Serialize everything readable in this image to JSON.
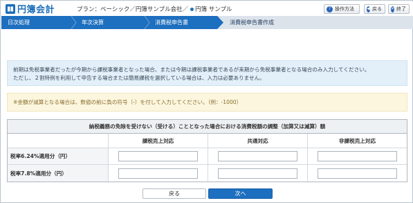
{
  "header": {
    "app_name": "円簿会計",
    "plan_text": "プラン：ベーシック／円簿サンプル会社／",
    "user_name": "円簿 サンプル",
    "help_label": "操作方法",
    "back_label": "戻る",
    "exit_label": "終了"
  },
  "steps": [
    {
      "label": "日次処理"
    },
    {
      "label": "年次決算"
    },
    {
      "label": "消費税申告書"
    },
    {
      "label": "消費税申告書作成"
    }
  ],
  "info": {
    "line1": "前期は免税事業者だったが今期から課税事業者となった場合、または今期は課税事業者であるが来期から免税事業者となる場合のみ入力してください。",
    "line2": "ただし、２割特例を利用して申告する場合または簡易課税を選択している場合は、入力は必要ありません。"
  },
  "note": "※金額が減算となる場合は、数値の前に負の符号（-）を付して入力してください。（例：-1000）",
  "table": {
    "title": "納税義務の免除を受けない（受ける）こととなった場合における消費税額の調整（加算又は減算）額",
    "columns": [
      "課税売上対応",
      "共通対応",
      "非課税売上対応"
    ],
    "rows": [
      {
        "label": "税率6.24%適用分（円）",
        "values": [
          "",
          "",
          ""
        ]
      },
      {
        "label": "税率7.8%適用分（円）",
        "values": [
          "",
          "",
          ""
        ]
      }
    ]
  },
  "footer": {
    "prev_label": "戻る",
    "next_label": "次へ"
  },
  "colors": {
    "brand": "#1e6fba",
    "step_bar": "#1d6fbf",
    "info_bg": "#e3f0f9",
    "note_bg": "#fcf6de"
  }
}
